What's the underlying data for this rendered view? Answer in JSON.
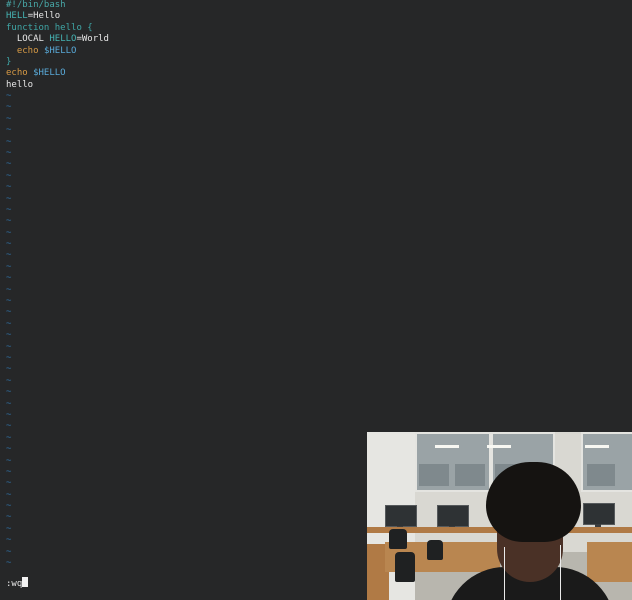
{
  "editor": {
    "lines": [
      [
        {
          "text": "#!/bin/bash",
          "cls": "c-comment"
        }
      ],
      [
        {
          "text": "HELL",
          "cls": "c-var"
        },
        {
          "text": "=Hello",
          "cls": "c-plain"
        }
      ],
      [
        {
          "text": "function hello {",
          "cls": "c-kw"
        }
      ],
      [
        {
          "text": "  LOCAL ",
          "cls": "c-plain"
        },
        {
          "text": "HELLO",
          "cls": "c-var"
        },
        {
          "text": "=World",
          "cls": "c-plain"
        }
      ],
      [
        {
          "text": "  echo ",
          "cls": "c-echo"
        },
        {
          "text": "$HELLO",
          "cls": "c-dollar"
        }
      ],
      [
        {
          "text": "}",
          "cls": "c-kw"
        }
      ],
      [
        {
          "text": "echo ",
          "cls": "c-echo"
        },
        {
          "text": "$HELLO",
          "cls": "c-dollar"
        }
      ],
      [
        {
          "text": "hello",
          "cls": "c-plain"
        }
      ]
    ],
    "tilde_char": "~",
    "tilde_count": 42,
    "command_line": ":wq"
  },
  "colors": {
    "background": "#262728",
    "comment": "#48a8a8",
    "variable": "#45b3b3",
    "keyword": "#3fa6a6",
    "echo": "#d79a45",
    "dollar": "#59a9d8",
    "tilde": "#2f6ea0",
    "text": "#e6e6e6"
  },
  "webcam": {
    "content": "webcam-feed-person-in-computer-lab"
  }
}
